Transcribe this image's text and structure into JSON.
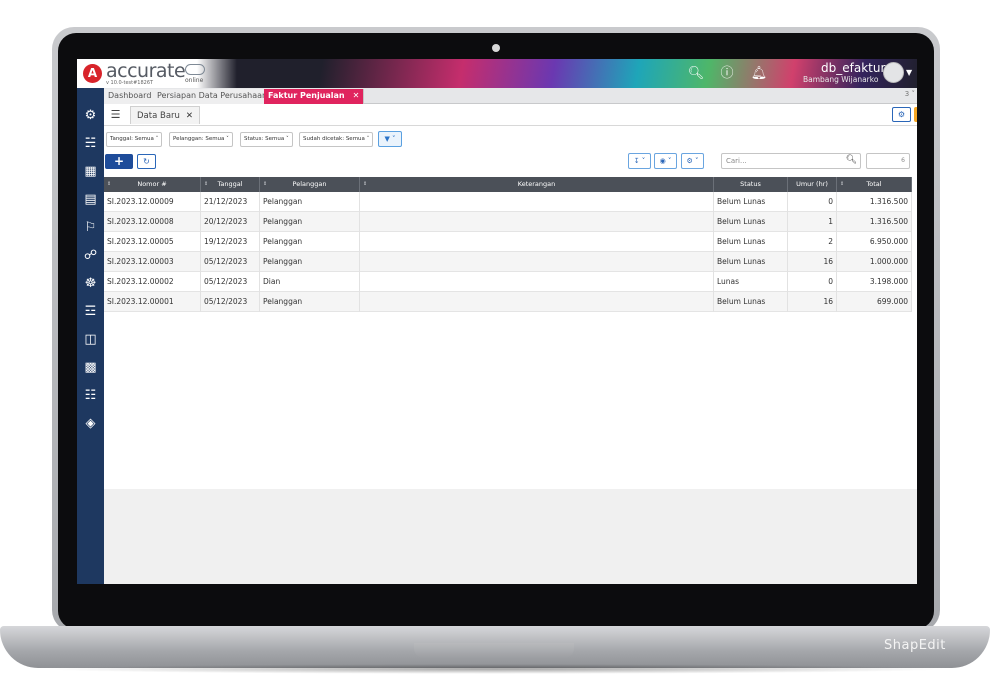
{
  "app": {
    "logo_letter": "A",
    "logo_name": "accurate",
    "logo_sub": "online",
    "version": "v 10.0-test#1826T",
    "db_name": "db_efaktur",
    "user_name": "Bambang Wijanarko"
  },
  "topbar_icons": [
    "search-icon",
    "help-icon",
    "bell-icon"
  ],
  "tabs": [
    {
      "label": "Dashboard",
      "active": false
    },
    {
      "label": "Persiapan Data Perusahaan",
      "active": false
    },
    {
      "label": "Faktur Penjualan",
      "active": true
    }
  ],
  "tab_counter": "3",
  "subtab": {
    "label": "Data Baru"
  },
  "filters": [
    {
      "label": "Tanggal: Semua"
    },
    {
      "label": "Pelanggan: Semua"
    },
    {
      "label": "Status: Semua"
    },
    {
      "label": "Sudah dicetak: Semua"
    }
  ],
  "search": {
    "placeholder": "Cari..."
  },
  "count_value": "6",
  "colors": {
    "accent_pink": "#e0245e",
    "sidebar_navy": "#1e3860",
    "primary_blue": "#1e4c9a",
    "warning_orange": "#f5a623"
  },
  "table": {
    "columns": [
      "Nomor #",
      "Tanggal",
      "Pelanggan",
      "Keterangan",
      "Status",
      "Umur (hr)",
      "Total"
    ],
    "rows": [
      {
        "nomor": "SI.2023.12.00009",
        "tanggal": "21/12/2023",
        "pelanggan": "Pelanggan",
        "keterangan": "",
        "status": "Belum Lunas",
        "umur": "0",
        "total": "1.316.500"
      },
      {
        "nomor": "SI.2023.12.00008",
        "tanggal": "20/12/2023",
        "pelanggan": "Pelanggan",
        "keterangan": "",
        "status": "Belum Lunas",
        "umur": "1",
        "total": "1.316.500"
      },
      {
        "nomor": "SI.2023.12.00005",
        "tanggal": "19/12/2023",
        "pelanggan": "Pelanggan",
        "keterangan": "",
        "status": "Belum Lunas",
        "umur": "2",
        "total": "6.950.000"
      },
      {
        "nomor": "SI.2023.12.00003",
        "tanggal": "05/12/2023",
        "pelanggan": "Pelanggan",
        "keterangan": "",
        "status": "Belum Lunas",
        "umur": "16",
        "total": "1.000.000"
      },
      {
        "nomor": "SI.2023.12.00002",
        "tanggal": "05/12/2023",
        "pelanggan": "Dian",
        "keterangan": "",
        "status": "Lunas",
        "umur": "0",
        "total": "3.198.000"
      },
      {
        "nomor": "SI.2023.12.00001",
        "tanggal": "05/12/2023",
        "pelanggan": "Pelanggan",
        "keterangan": "",
        "status": "Belum Lunas",
        "umur": "16",
        "total": "699.000"
      }
    ]
  },
  "watermark": "ShapEdit"
}
